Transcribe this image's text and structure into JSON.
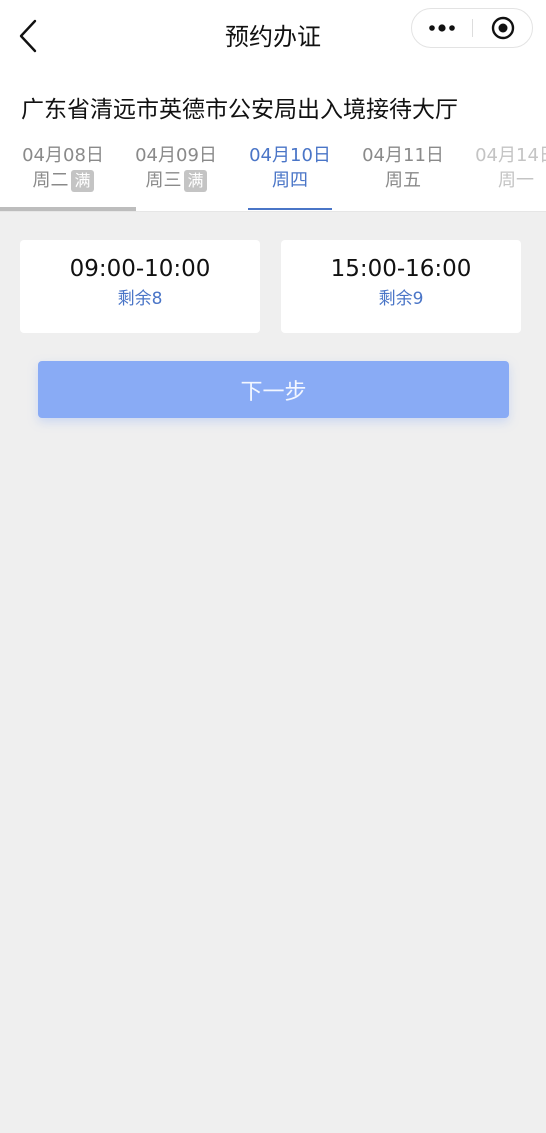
{
  "header": {
    "title": "预约办证",
    "back_icon": "chevron-left-icon",
    "more_icon": "more-dots-icon",
    "close_icon": "target-circle-icon"
  },
  "office_name": "广东省清远市英德市公安局出入境接待大厅",
  "dates": [
    {
      "date": "04月08日",
      "weekday": "周二",
      "badge": "满"
    },
    {
      "date": "04月09日",
      "weekday": "周三",
      "badge": "满"
    },
    {
      "date": "04月10日",
      "weekday": "周四",
      "badge": ""
    },
    {
      "date": "04月11日",
      "weekday": "周五",
      "badge": ""
    },
    {
      "date": "04月14日",
      "weekday": "周一",
      "badge": ""
    }
  ],
  "selected_date_index": 2,
  "slots": [
    {
      "time": "09:00-10:00",
      "remaining": "剩余8"
    },
    {
      "time": "15:00-16:00",
      "remaining": "剩余9"
    }
  ],
  "next_button_label": "下一步",
  "colors": {
    "accent": "#4a75c7",
    "button": "#89abf5",
    "background": "#efefef",
    "badge": "#c4c4c4"
  }
}
